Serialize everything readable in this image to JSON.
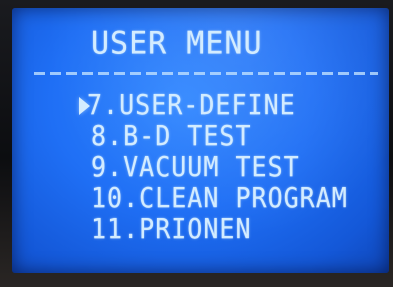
{
  "screen": {
    "title": "USER MENU",
    "selected_index": 0,
    "items": [
      {
        "label": "7.USER-DEFINE"
      },
      {
        "label": "8.B-D TEST"
      },
      {
        "label": "9.VACUUM TEST"
      },
      {
        "label": "10.CLEAN PROGRAM"
      },
      {
        "label": "11.PRIONEN"
      }
    ]
  },
  "colors": {
    "screen_background": "#1f6ff5",
    "text": "#d3ecff"
  },
  "icons": {
    "selection_cursor": "triangle-right-icon"
  }
}
